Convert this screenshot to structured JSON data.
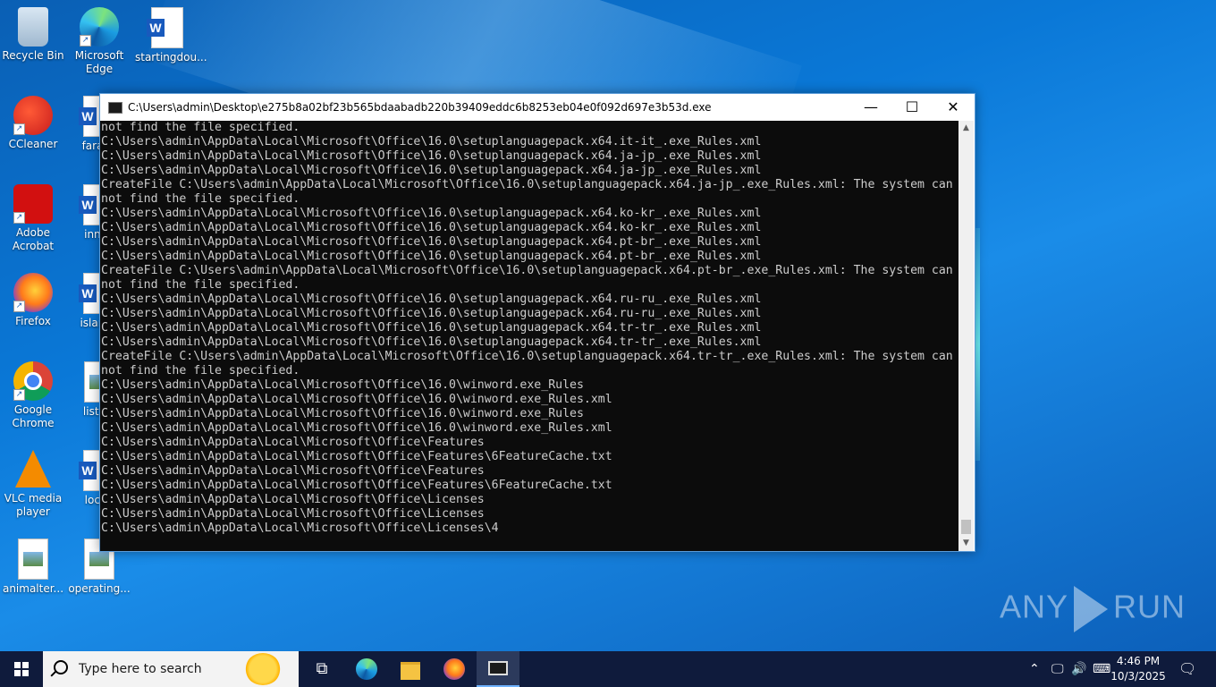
{
  "desktop": {
    "icons": [
      {
        "label": "Recycle Bin"
      },
      {
        "label": "Microsoft Edge"
      },
      {
        "label": "startingdou..."
      },
      {
        "label": "CCleaner"
      },
      {
        "label": "farage"
      },
      {
        "label": "Adobe Acrobat"
      },
      {
        "label": "innqu"
      },
      {
        "label": "Firefox"
      },
      {
        "label": "islandp"
      },
      {
        "label": "Google Chrome"
      },
      {
        "label": "listing"
      },
      {
        "label": "VLC media player"
      },
      {
        "label": "locati"
      },
      {
        "label": "animalter..."
      },
      {
        "label": "operating..."
      }
    ],
    "watermark": {
      "left": "ANY",
      "right": "RUN"
    }
  },
  "console": {
    "title": "C:\\Users\\admin\\Desktop\\e275b8a02bf23b565bdaabadb220b39409eddc6b8253eb04e0f092d697e3b53d.exe",
    "buttons": {
      "minimize": "—",
      "maximize": "☐",
      "close": "✕"
    },
    "lines": [
      "not find the file specified.",
      "C:\\Users\\admin\\AppData\\Local\\Microsoft\\Office\\16.0\\setuplanguagepack.x64.it-it_.exe_Rules.xml",
      "C:\\Users\\admin\\AppData\\Local\\Microsoft\\Office\\16.0\\setuplanguagepack.x64.ja-jp_.exe_Rules.xml",
      "C:\\Users\\admin\\AppData\\Local\\Microsoft\\Office\\16.0\\setuplanguagepack.x64.ja-jp_.exe_Rules.xml",
      "CreateFile C:\\Users\\admin\\AppData\\Local\\Microsoft\\Office\\16.0\\setuplanguagepack.x64.ja-jp_.exe_Rules.xml: The system can",
      "not find the file specified.",
      "C:\\Users\\admin\\AppData\\Local\\Microsoft\\Office\\16.0\\setuplanguagepack.x64.ko-kr_.exe_Rules.xml",
      "C:\\Users\\admin\\AppData\\Local\\Microsoft\\Office\\16.0\\setuplanguagepack.x64.ko-kr_.exe_Rules.xml",
      "C:\\Users\\admin\\AppData\\Local\\Microsoft\\Office\\16.0\\setuplanguagepack.x64.pt-br_.exe_Rules.xml",
      "C:\\Users\\admin\\AppData\\Local\\Microsoft\\Office\\16.0\\setuplanguagepack.x64.pt-br_.exe_Rules.xml",
      "CreateFile C:\\Users\\admin\\AppData\\Local\\Microsoft\\Office\\16.0\\setuplanguagepack.x64.pt-br_.exe_Rules.xml: The system can",
      "not find the file specified.",
      "C:\\Users\\admin\\AppData\\Local\\Microsoft\\Office\\16.0\\setuplanguagepack.x64.ru-ru_.exe_Rules.xml",
      "C:\\Users\\admin\\AppData\\Local\\Microsoft\\Office\\16.0\\setuplanguagepack.x64.ru-ru_.exe_Rules.xml",
      "C:\\Users\\admin\\AppData\\Local\\Microsoft\\Office\\16.0\\setuplanguagepack.x64.tr-tr_.exe_Rules.xml",
      "C:\\Users\\admin\\AppData\\Local\\Microsoft\\Office\\16.0\\setuplanguagepack.x64.tr-tr_.exe_Rules.xml",
      "CreateFile C:\\Users\\admin\\AppData\\Local\\Microsoft\\Office\\16.0\\setuplanguagepack.x64.tr-tr_.exe_Rules.xml: The system can",
      "not find the file specified.",
      "C:\\Users\\admin\\AppData\\Local\\Microsoft\\Office\\16.0\\winword.exe_Rules",
      "C:\\Users\\admin\\AppData\\Local\\Microsoft\\Office\\16.0\\winword.exe_Rules.xml",
      "C:\\Users\\admin\\AppData\\Local\\Microsoft\\Office\\16.0\\winword.exe_Rules",
      "C:\\Users\\admin\\AppData\\Local\\Microsoft\\Office\\16.0\\winword.exe_Rules.xml",
      "C:\\Users\\admin\\AppData\\Local\\Microsoft\\Office\\Features",
      "C:\\Users\\admin\\AppData\\Local\\Microsoft\\Office\\Features\\6FeatureCache.txt",
      "C:\\Users\\admin\\AppData\\Local\\Microsoft\\Office\\Features",
      "C:\\Users\\admin\\AppData\\Local\\Microsoft\\Office\\Features\\6FeatureCache.txt",
      "C:\\Users\\admin\\AppData\\Local\\Microsoft\\Office\\Licenses",
      "C:\\Users\\admin\\AppData\\Local\\Microsoft\\Office\\Licenses",
      "C:\\Users\\admin\\AppData\\Local\\Microsoft\\Office\\Licenses\\4"
    ]
  },
  "taskbar": {
    "search_placeholder": "Type here to search",
    "apps": [
      "task-view-icon",
      "edge-icon",
      "file-explorer-icon",
      "firefox-icon",
      "console-icon"
    ],
    "clock": {
      "time": "4:46 PM",
      "date": "10/3/2025"
    }
  }
}
